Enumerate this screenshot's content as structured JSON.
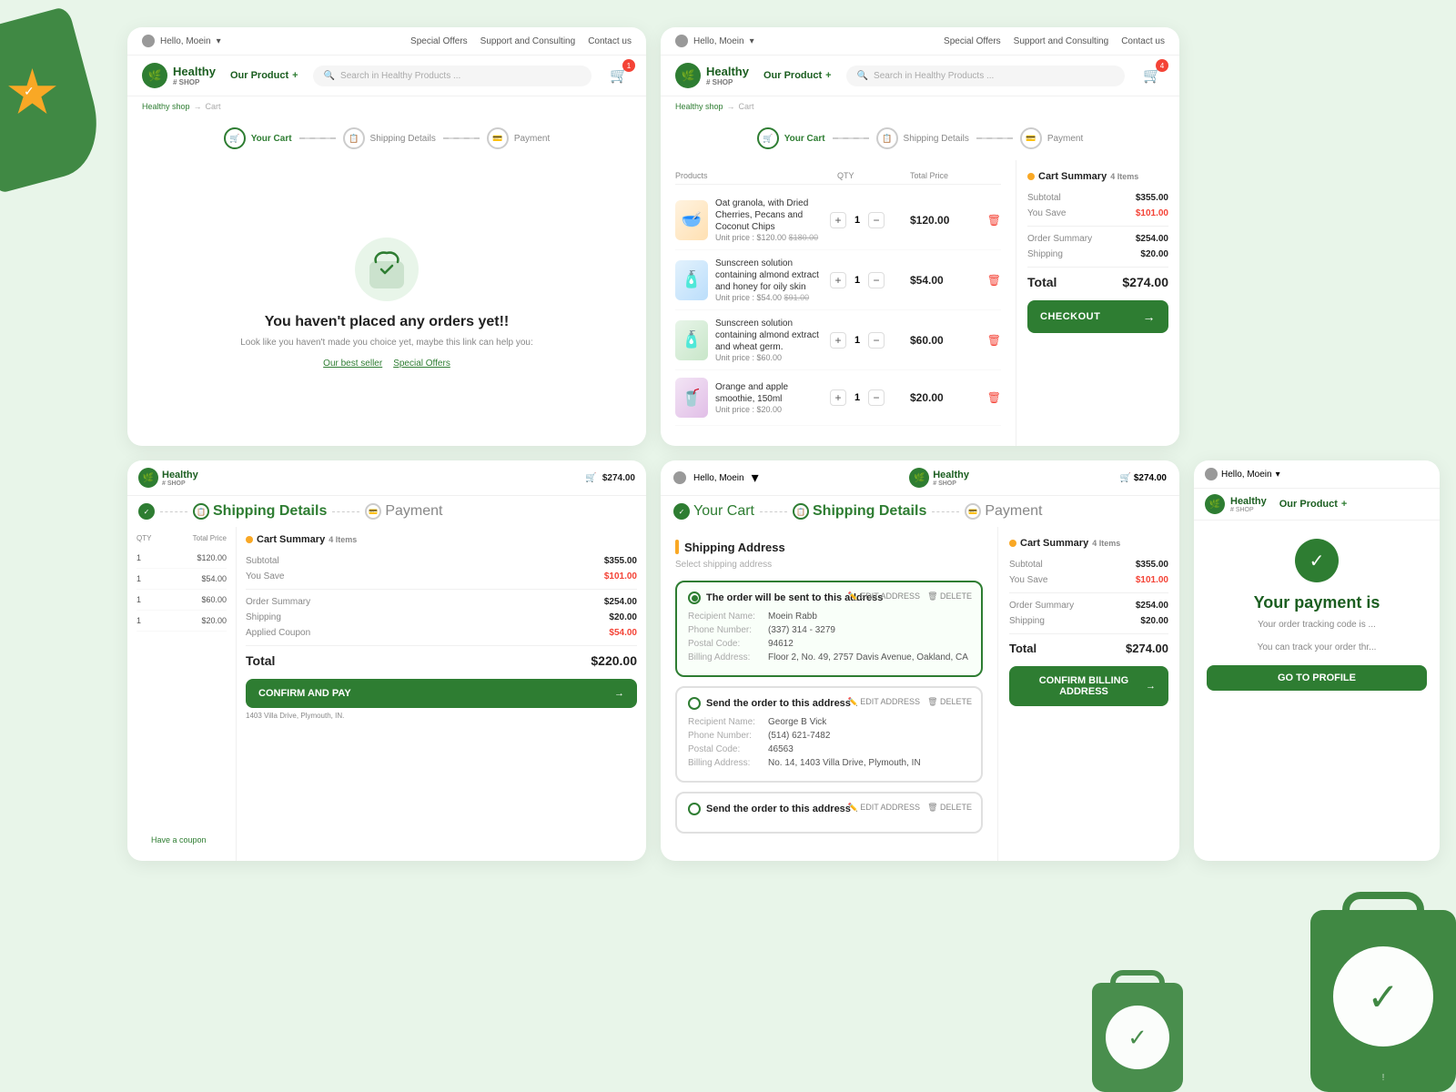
{
  "brand": {
    "name": "Healthy",
    "sub": "# SHOP",
    "icon": "🌿"
  },
  "topbar": {
    "user": "Hello, Moein",
    "links": [
      "Special Offers",
      "Support and Consulting",
      "Contact us"
    ]
  },
  "nav": {
    "product_btn": "Our Product",
    "search_placeholder": "Search in Healthy Products ...",
    "cart_count": "1"
  },
  "breadcrumb": [
    "Healthy shop",
    "Cart"
  ],
  "stepper": {
    "steps": [
      {
        "label": "Your Cart",
        "icon": "🛒",
        "state": "active"
      },
      {
        "label": "Shipping Details",
        "icon": "📋",
        "state": "inactive"
      },
      {
        "label": "Payment",
        "icon": "💳",
        "state": "inactive"
      }
    ]
  },
  "empty_cart": {
    "title": "You haven't placed any orders yet!!",
    "subtitle": "Look like you haven't made you choice yet, maybe this link can help you:",
    "link1": "Our best seller",
    "link2": "Special Offers"
  },
  "cart": {
    "table_headers": [
      "Products",
      "QTY",
      "Total Price"
    ],
    "items": [
      {
        "name": "Oat granola, with Dried Cherries, Pecans and Coconut Chips",
        "unit_price": "$120.00",
        "old_price": "$180.00",
        "qty": 1,
        "total": "$120.00",
        "emoji": "🥣",
        "type": "food"
      },
      {
        "name": "Sunscreen solution containing almond extract and honey for oily skin",
        "unit_price": "$54.00",
        "old_price": "$91.00",
        "qty": 1,
        "total": "$54.00",
        "emoji": "🧴",
        "type": "bottle"
      },
      {
        "name": "Sunscreen solution containing almond extract and wheat germ.",
        "unit_price": "$60.00",
        "old_price": "",
        "qty": 1,
        "total": "$60.00",
        "emoji": "🧴",
        "type": "bottle2"
      },
      {
        "name": "Orange and apple smoothie, 150ml",
        "unit_price": "$20.00",
        "old_price": "",
        "qty": 1,
        "total": "$20.00",
        "emoji": "🥤",
        "type": "smoothie"
      }
    ]
  },
  "cart_summary": {
    "title": "Cart Summary",
    "count": "4 Items",
    "subtotal_label": "Subtotal",
    "subtotal_val": "$355.00",
    "save_label": "You Save",
    "save_val": "$101.00",
    "order_summary_label": "Order Summary",
    "order_summary_val": "$254.00",
    "shipping_label": "Shipping",
    "shipping_val": "$20.00",
    "total_label": "Total",
    "total_val": "$274.00",
    "checkout_btn": "CHECKOUT"
  },
  "shipping_summary": {
    "title": "Cart Summary",
    "count": "4 Items",
    "subtotal_label": "Subtotal",
    "subtotal_val": "$355.00",
    "save_label": "You Save",
    "save_val": "$101.00",
    "order_summary_label": "Order Summary",
    "order_summary_val": "$254.00",
    "shipping_label": "Shipping",
    "shipping_val": "$20.00",
    "coupon_label": "Applied Coupon",
    "coupon_val": "$54.00",
    "total_label": "Total",
    "total_val": "$220.00",
    "confirm_btn": "CONFIRM AND PAY",
    "address_text": "1403 Villa Drive, Plymouth, IN."
  },
  "shipping_address": {
    "title": "Shipping Address",
    "select_label": "Select shipping address",
    "addresses": [
      {
        "label": "The order will be sent to this address",
        "selected": true,
        "recipient": "Moein Rabb",
        "phone": "(337) 314 - 3279",
        "postal": "94612",
        "billing": "Floor 2, No. 49, 2757 Davis Avenue, Oakland, CA"
      },
      {
        "label": "Send the order to this address",
        "selected": false,
        "recipient": "George B Vick",
        "phone": "(514) 621-7482",
        "postal": "46563",
        "billing": "No. 14, 1403 Villa Drive, Plymouth, IN"
      },
      {
        "label": "Send the order to this address",
        "selected": false,
        "recipient": "",
        "phone": "",
        "postal": "",
        "billing": ""
      }
    ],
    "confirm_btn": "CONFIRM BILLING ADDRESS"
  },
  "payment_success": {
    "title": "Your payment is",
    "sub1": "Your order tracking code is ...",
    "sub2": "You can track your order thr...",
    "go_profile_btn": "GO TO PROFILE"
  },
  "mini_cart_badge": "$274.00",
  "have_coupon": "Have a coupon"
}
